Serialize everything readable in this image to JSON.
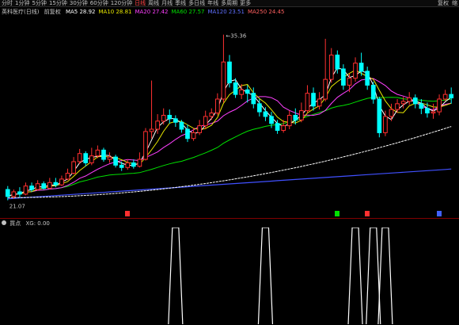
{
  "toolbar": {
    "items": [
      "分时",
      "1分钟",
      "5分钟",
      "15分钟",
      "30分钟",
      "60分钟",
      "120分钟",
      "日线",
      "周线",
      "月线",
      "季线",
      "多日线",
      "年线",
      "多周期"
    ],
    "active_index": 7,
    "more": "更多",
    "right": [
      "复权",
      "缩"
    ]
  },
  "main": {
    "title": "英科医疗(日线)",
    "mode": "前复权",
    "ma": [
      {
        "label": "MA5",
        "value": "28.92",
        "color": "#ffffff"
      },
      {
        "label": "MA10",
        "value": "28.81",
        "color": "#e8e800"
      },
      {
        "label": "MA20",
        "value": "27.42",
        "color": "#ff40ff"
      },
      {
        "label": "MA60",
        "value": "27.57",
        "color": "#00e000"
      },
      {
        "label": "MA120",
        "value": "23.51",
        "color": "#6070ff"
      },
      {
        "label": "MA250",
        "value": "24.45",
        "color": "#ff6060"
      }
    ],
    "high_label": "35.36",
    "low_label": "21.07"
  },
  "sub": {
    "title": "買点",
    "value": "XG: 0.00"
  },
  "colors": {
    "up": "#ff3030",
    "down": "#00ffff",
    "ma5": "#ffffff",
    "ma10": "#e8e800",
    "ma20": "#ff40ff",
    "ma60": "#00e000",
    "ma120": "#4050ff",
    "ma250": "#ffffff"
  },
  "chart_data": {
    "type": "candlestick",
    "ylim": [
      20.5,
      36.5
    ],
    "candles": [
      [
        22.0,
        21.4,
        22.3,
        21.07
      ],
      [
        21.4,
        21.8,
        22.0,
        21.2
      ],
      [
        21.8,
        21.6,
        22.2,
        21.3
      ],
      [
        21.6,
        22.3,
        22.6,
        21.5
      ],
      [
        22.3,
        22.0,
        22.6,
        21.8
      ],
      [
        22.0,
        22.5,
        22.8,
        21.9
      ],
      [
        22.5,
        22.1,
        22.7,
        22.0
      ],
      [
        22.1,
        22.6,
        23.0,
        22.0
      ],
      [
        22.6,
        22.4,
        23.0,
        22.2
      ],
      [
        22.4,
        22.9,
        23.2,
        22.3
      ],
      [
        22.9,
        23.4,
        23.8,
        22.8
      ],
      [
        23.4,
        24.4,
        24.8,
        23.3
      ],
      [
        24.4,
        25.1,
        25.5,
        24.2
      ],
      [
        25.1,
        24.3,
        25.3,
        24.0
      ],
      [
        24.3,
        24.9,
        25.6,
        24.1
      ],
      [
        24.9,
        25.4,
        25.8,
        24.7
      ],
      [
        25.4,
        24.6,
        25.6,
        24.4
      ],
      [
        24.6,
        24.8,
        25.2,
        24.3
      ],
      [
        24.8,
        24.1,
        25.0,
        23.9
      ],
      [
        24.1,
        23.9,
        24.4,
        23.6
      ],
      [
        23.9,
        24.3,
        24.6,
        23.7
      ],
      [
        24.3,
        24.0,
        24.6,
        23.8
      ],
      [
        24.0,
        24.6,
        25.2,
        23.9
      ],
      [
        24.6,
        27.0,
        27.3,
        24.5
      ],
      [
        27.0,
        27.2,
        31.4,
        26.4
      ],
      [
        27.2,
        27.9,
        28.5,
        26.8
      ],
      [
        27.9,
        28.4,
        29.0,
        27.6
      ],
      [
        28.4,
        28.1,
        28.9,
        27.7
      ],
      [
        28.1,
        27.8,
        28.4,
        27.4
      ],
      [
        27.8,
        27.2,
        28.0,
        26.9
      ],
      [
        27.2,
        26.4,
        27.6,
        26.1
      ],
      [
        26.4,
        26.9,
        27.3,
        26.2
      ],
      [
        26.9,
        27.5,
        28.0,
        26.7
      ],
      [
        27.5,
        28.3,
        28.8,
        27.2
      ],
      [
        28.3,
        28.6,
        29.0,
        28.0
      ],
      [
        28.6,
        29.8,
        30.3,
        28.4
      ],
      [
        29.8,
        33.0,
        35.36,
        29.5
      ],
      [
        33.0,
        31.2,
        33.6,
        30.8
      ],
      [
        31.2,
        30.2,
        31.6,
        29.9
      ],
      [
        30.2,
        30.6,
        31.1,
        29.8
      ],
      [
        30.6,
        30.3,
        31.0,
        29.5
      ],
      [
        30.3,
        29.4,
        30.8,
        29.0
      ],
      [
        29.4,
        28.7,
        29.8,
        28.3
      ],
      [
        28.7,
        28.3,
        29.1,
        27.9
      ],
      [
        28.3,
        27.7,
        28.7,
        27.3
      ],
      [
        27.7,
        27.1,
        28.0,
        26.8
      ],
      [
        27.1,
        27.5,
        28.0,
        26.9
      ],
      [
        27.5,
        28.4,
        28.8,
        27.2
      ],
      [
        28.4,
        28.0,
        29.0,
        27.6
      ],
      [
        28.0,
        28.8,
        29.5,
        27.8
      ],
      [
        28.8,
        30.3,
        31.0,
        28.6
      ],
      [
        30.3,
        29.2,
        30.8,
        28.8
      ],
      [
        29.2,
        29.8,
        30.4,
        28.9
      ],
      [
        29.8,
        31.5,
        35.0,
        29.6
      ],
      [
        31.5,
        33.6,
        34.2,
        31.2
      ],
      [
        33.6,
        32.4,
        34.0,
        32.0
      ],
      [
        32.4,
        31.0,
        32.8,
        30.6
      ],
      [
        31.0,
        31.6,
        32.0,
        30.4
      ],
      [
        31.6,
        32.9,
        33.4,
        31.3
      ],
      [
        32.9,
        32.2,
        33.8,
        31.8
      ],
      [
        32.2,
        31.0,
        32.6,
        30.6
      ],
      [
        31.0,
        29.8,
        31.3,
        29.4
      ],
      [
        29.8,
        26.9,
        30.0,
        26.5
      ],
      [
        26.9,
        28.3,
        28.8,
        26.6
      ],
      [
        28.3,
        28.9,
        29.4,
        27.9
      ],
      [
        28.9,
        29.4,
        29.8,
        28.6
      ],
      [
        29.4,
        29.6,
        30.0,
        29.0
      ],
      [
        29.6,
        29.9,
        30.4,
        29.3
      ],
      [
        29.9,
        29.4,
        30.2,
        29.0
      ],
      [
        29.4,
        29.0,
        29.8,
        28.5
      ],
      [
        29.0,
        28.6,
        29.5,
        28.2
      ],
      [
        28.6,
        28.7,
        29.4,
        28.1
      ],
      [
        28.7,
        29.8,
        30.2,
        28.4
      ],
      [
        29.8,
        30.2,
        30.6,
        29.6
      ],
      [
        30.2,
        29.9,
        30.8,
        29.4
      ]
    ],
    "signals": [
      28,
      43,
      58,
      61,
      63,
      77
    ],
    "marker_positions": [
      {
        "i": 20,
        "type": "S",
        "color": "#ff3030"
      },
      {
        "i": 55,
        "type": "B",
        "color": "#00e000"
      },
      {
        "i": 60,
        "type": "S",
        "color": "#ff3030"
      },
      {
        "i": 72,
        "type": "B",
        "color": "#4060ff"
      }
    ]
  }
}
